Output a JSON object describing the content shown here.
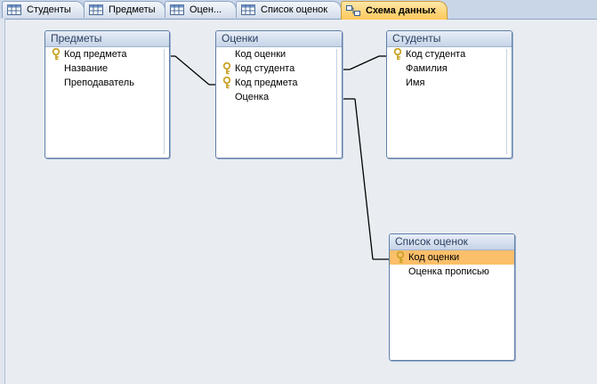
{
  "tabs": [
    {
      "label": "Студенты",
      "icon": "table-icon"
    },
    {
      "label": "Предметы",
      "icon": "table-icon"
    },
    {
      "label": "Оцен...",
      "icon": "table-icon"
    },
    {
      "label": "Список оценок",
      "icon": "table-icon"
    },
    {
      "label": "Схема данных",
      "icon": "relationships-icon"
    }
  ],
  "tables": {
    "predmety": {
      "title": "Предметы",
      "fields": [
        {
          "name": "Код предмета",
          "key": true
        },
        {
          "name": "Название",
          "key": false
        },
        {
          "name": "Преподаватель",
          "key": false
        }
      ]
    },
    "ocenki": {
      "title": "Оценки",
      "fields": [
        {
          "name": "Код оценки",
          "key": false
        },
        {
          "name": "Код студента",
          "key": true
        },
        {
          "name": "Код предмета",
          "key": true
        },
        {
          "name": "Оценка",
          "key": false
        }
      ]
    },
    "studenty": {
      "title": "Студенты",
      "fields": [
        {
          "name": "Код студента",
          "key": true
        },
        {
          "name": "Фамилия",
          "key": false
        },
        {
          "name": "Имя",
          "key": false
        }
      ]
    },
    "spisok": {
      "title": "Список оценок",
      "fields": [
        {
          "name": "Код оценки",
          "key": true,
          "selected": true
        },
        {
          "name": "Оценка прописью",
          "key": false
        }
      ]
    }
  },
  "colors": {
    "key_icon": "#c9a227",
    "selected_row": "#fcbf6a",
    "active_tab": "#ffc85a"
  }
}
